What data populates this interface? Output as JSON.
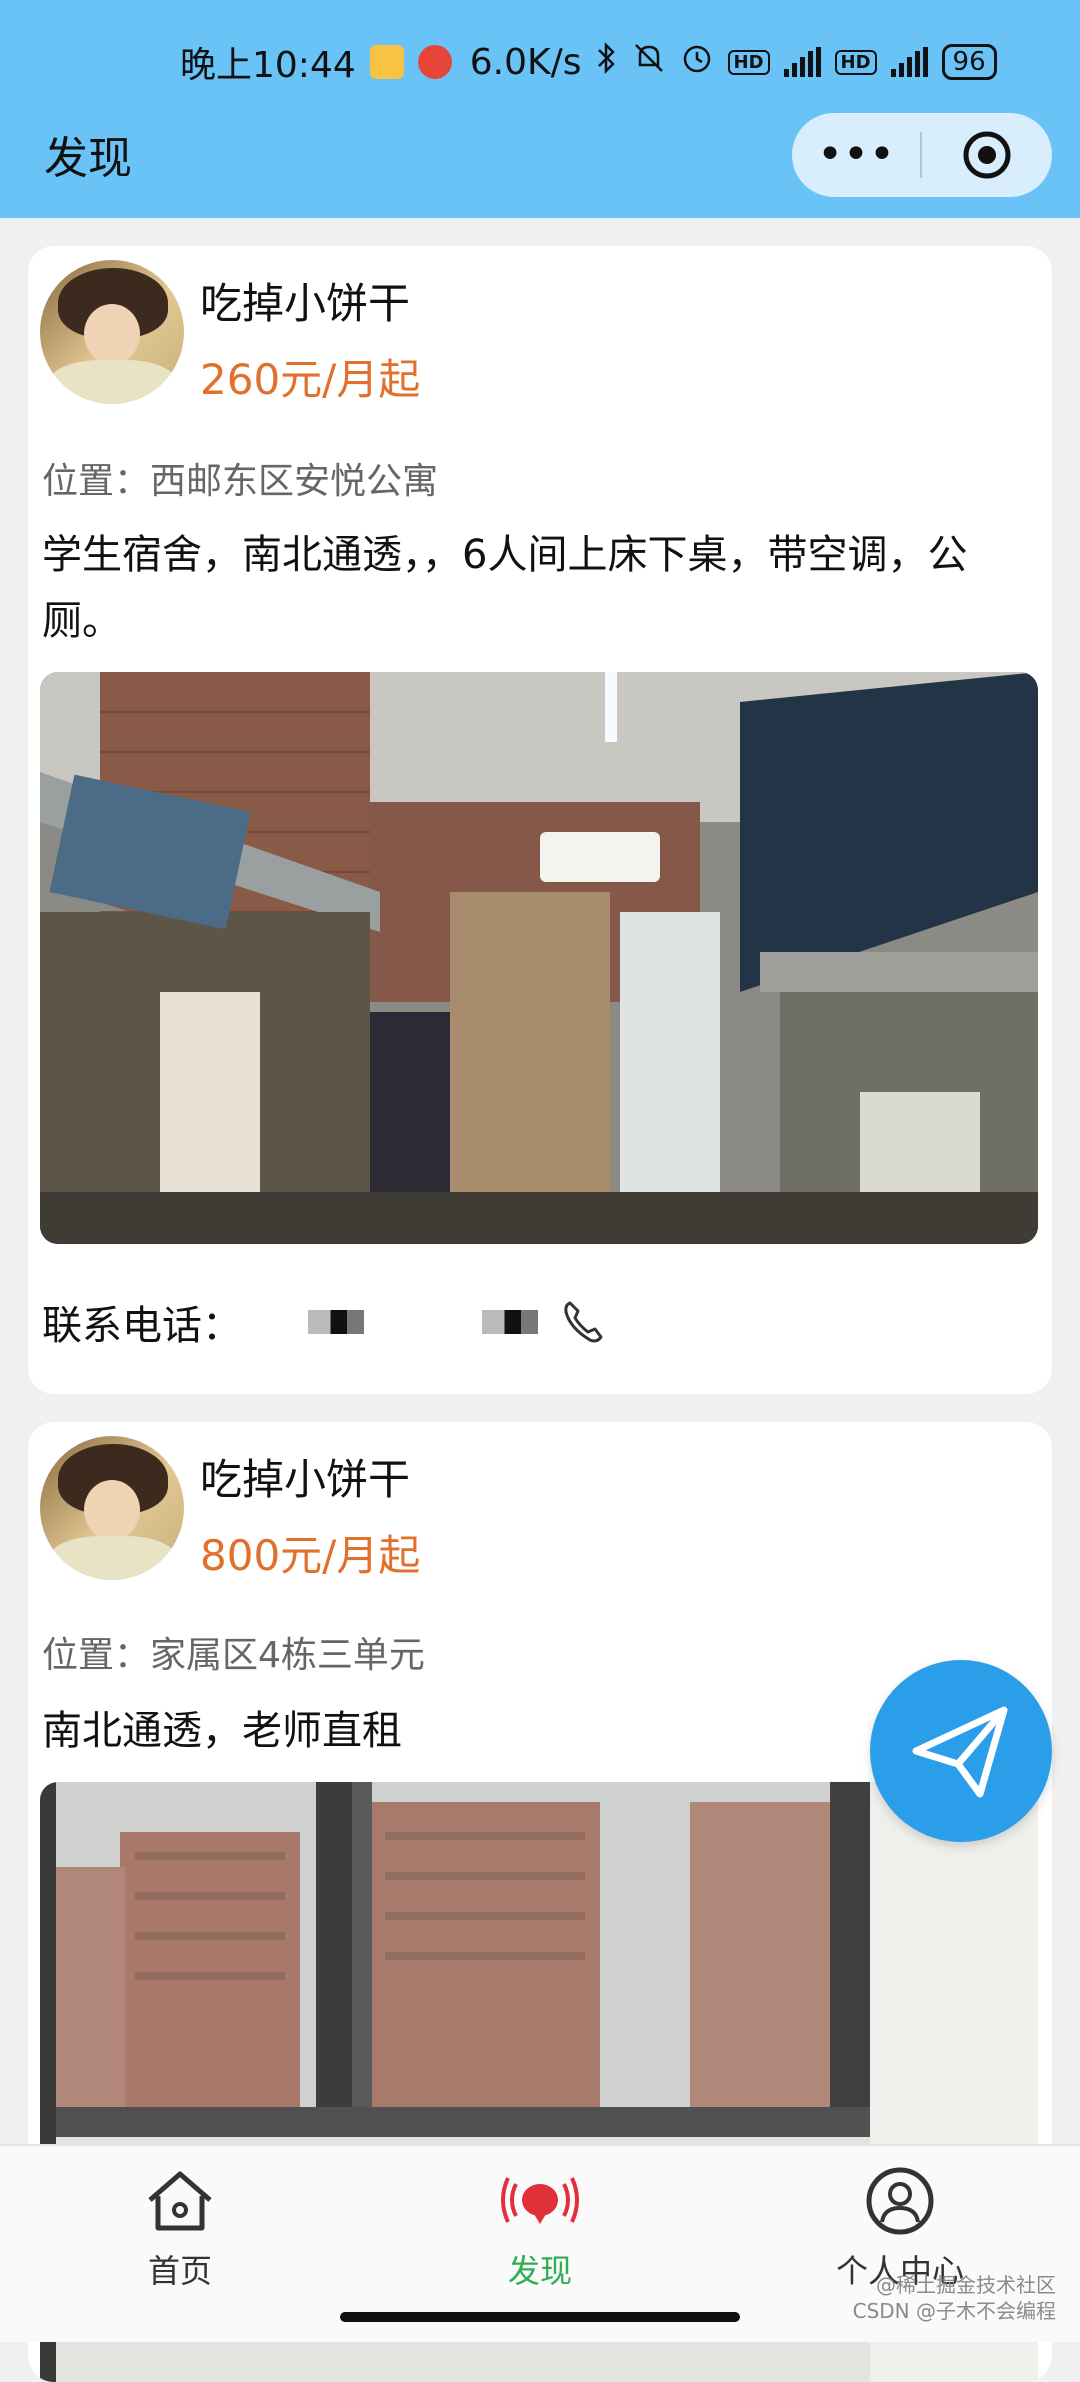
{
  "status_bar": {
    "time": "晚上10:44",
    "speed": "6.0K/s",
    "battery": "96"
  },
  "nav": {
    "title": "发现",
    "more_label": "•••"
  },
  "posts": [
    {
      "username": "吃掉小饼干",
      "price": "260元/月起",
      "location": "位置：西邮东区安悦公寓",
      "description": "学生宿舍，南北通透，，6人间上床下桌，带空调，公厕。",
      "contact_label": "联系电话："
    },
    {
      "username": "吃掉小饼干",
      "price": "800元/月起",
      "location": "位置：家属区4栋三单元",
      "description": "南北通透，老师直租"
    }
  ],
  "tabs": [
    {
      "label": "首页"
    },
    {
      "label": "发现"
    },
    {
      "label": "个人中心"
    }
  ],
  "colors": {
    "header": "#69c3f7",
    "price": "#e0702b",
    "active_tab": "#2fae54",
    "fab": "#2a9ee8"
  },
  "watermark": {
    "line1": "@稀土掘金技术社区",
    "line2": "CSDN @子木不会编程"
  }
}
